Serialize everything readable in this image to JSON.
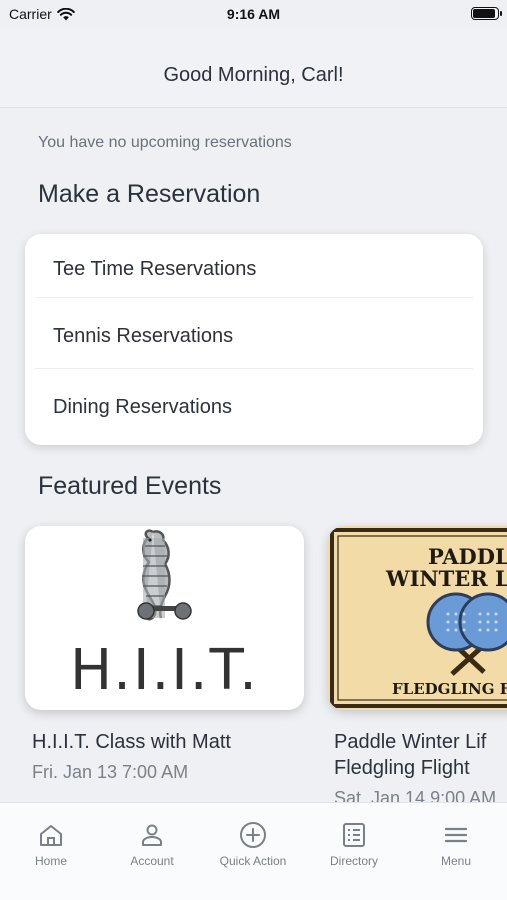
{
  "status": {
    "carrier": "Carrier",
    "time": "9:16 AM"
  },
  "header": {
    "greeting": "Good Morning, Carl!"
  },
  "reservations": {
    "empty_message": "You have no upcoming reservations",
    "section_title": "Make a Reservation",
    "items": [
      {
        "label": "Tee Time Reservations"
      },
      {
        "label": "Tennis Reservations"
      },
      {
        "label": "Dining Reservations"
      }
    ]
  },
  "featured": {
    "section_title": "Featured Events",
    "events": [
      {
        "image_text": "H.I.I.T.",
        "title": "H.I.I.T. Class with Matt",
        "date": "Fri. Jan 13 7:00 AM"
      },
      {
        "image_text_1": "PADDLE",
        "image_text_2": "WINTER LIF",
        "image_text_3": "FLEDGLING FLI",
        "title_line1": "Paddle Winter Lif",
        "title_line2": "Fledgling Flight",
        "date": "Sat. Jan 14 9:00 AM"
      }
    ]
  },
  "tabs": [
    {
      "label": "Home",
      "icon": "home-icon"
    },
    {
      "label": "Account",
      "icon": "account-icon"
    },
    {
      "label": "Quick Action",
      "icon": "plus-circle-icon"
    },
    {
      "label": "Directory",
      "icon": "directory-icon"
    },
    {
      "label": "Menu",
      "icon": "menu-icon"
    }
  ],
  "colors": {
    "background": "#eef0f4",
    "text": "#2b323c",
    "muted": "#7b818a",
    "paddle_bg": "#f2dba7",
    "paddle_blue": "#6b9bd6"
  }
}
